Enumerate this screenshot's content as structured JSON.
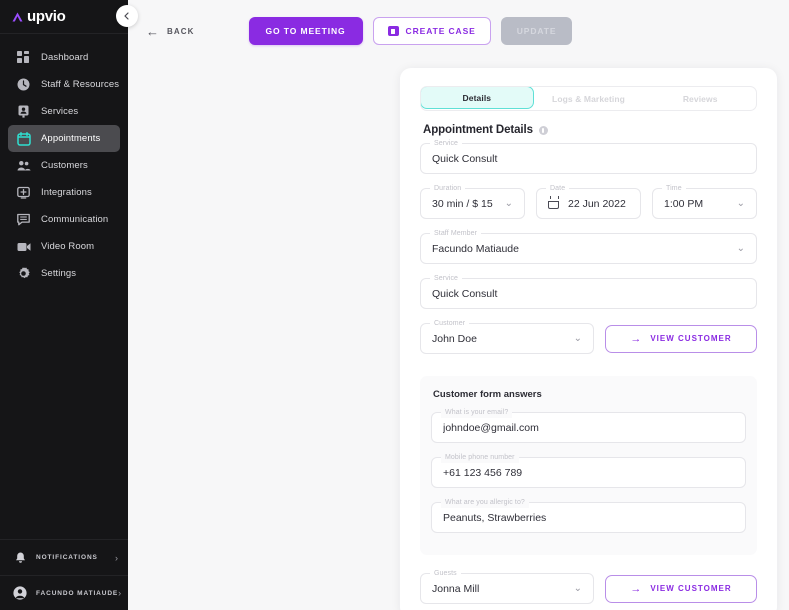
{
  "brand": {
    "name": "upvio",
    "accent": "#8A2BE2",
    "teal": "#5fe0d6"
  },
  "sidebar": {
    "collapse_icon": "chevron-left-icon",
    "items": [
      {
        "label": "Dashboard",
        "icon": "dashboard-icon",
        "active": false
      },
      {
        "label": "Staff & Resources",
        "icon": "clock-icon",
        "active": false
      },
      {
        "label": "Services",
        "icon": "services-icon",
        "active": false
      },
      {
        "label": "Appointments",
        "icon": "calendar-icon",
        "active": true
      },
      {
        "label": "Customers",
        "icon": "customers-icon",
        "active": false
      },
      {
        "label": "Integrations",
        "icon": "integrations-icon",
        "active": false
      },
      {
        "label": "Communication",
        "icon": "chat-icon",
        "active": false
      },
      {
        "label": "Video Room",
        "icon": "video-icon",
        "active": false
      },
      {
        "label": "Settings",
        "icon": "gear-icon",
        "active": false
      }
    ],
    "notifications": {
      "label": "NOTIFICATIONS",
      "icon": "bell-icon",
      "chevron": "›"
    },
    "account": {
      "label": "FACUNDO MATIAUDE",
      "icon": "avatar-icon",
      "chevron": "›"
    }
  },
  "toolbar": {
    "back_label": "BACK",
    "back_arrow": "←",
    "go_to_meeting_label": "GO TO MEETING",
    "create_case_label": "CREATE CASE",
    "update_label": "UPDATE"
  },
  "tabs": [
    {
      "label": "Details",
      "active": true
    },
    {
      "label": "Logs & Marketing",
      "active": false
    },
    {
      "label": "Reviews",
      "active": false
    }
  ],
  "details": {
    "section_title": "Appointment Details",
    "service": {
      "legend": "Service",
      "value": "Quick Consult"
    },
    "duration": {
      "legend": "Duration",
      "value": "30 min / $ 15",
      "chevron": "⌄"
    },
    "date": {
      "legend": "Date",
      "value": "22 Jun 2022"
    },
    "time": {
      "legend": "Time",
      "value": "1:00 PM",
      "chevron": "⌄"
    },
    "staff": {
      "legend": "Staff Member",
      "value": "Facundo Matiaude",
      "chevron": "⌄"
    },
    "service2": {
      "legend": "Service",
      "value": "Quick Consult"
    },
    "customer": {
      "legend": "Customer",
      "value": "John Doe",
      "chevron": "⌄"
    },
    "view_customer_label": "VIEW CUSTOMER",
    "view_customer_arrow": "→"
  },
  "form_answers": {
    "title": "Customer form answers",
    "fields": [
      {
        "legend": "What is your email?",
        "value": "johndoe@gmail.com"
      },
      {
        "legend": "Mobile phone number",
        "value": "+61 123 456 789"
      },
      {
        "legend": "What are you allergic to?",
        "value": "Peanuts, Strawberries"
      }
    ]
  },
  "guests": {
    "legend": "Guests",
    "value": "Jonna Mill",
    "chevron": "⌄",
    "view_customer_label": "VIEW CUSTOMER",
    "view_customer_arrow": "→"
  }
}
